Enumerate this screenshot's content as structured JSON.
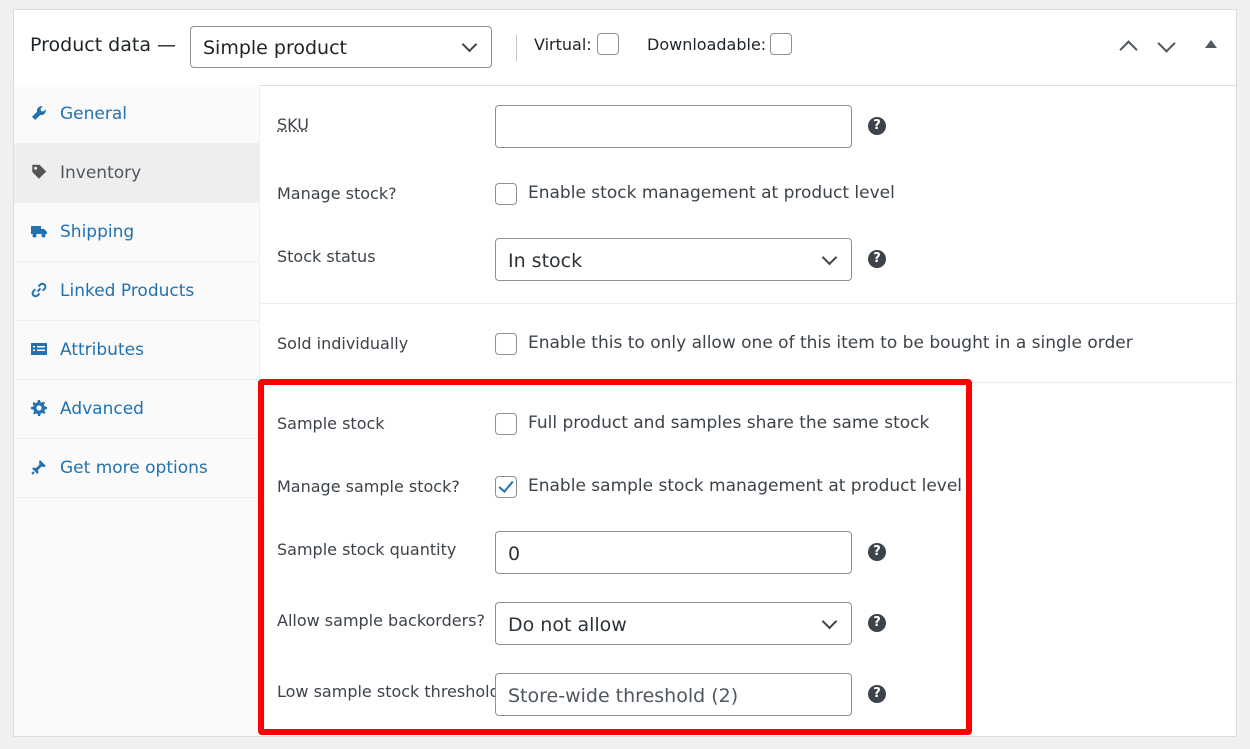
{
  "header": {
    "title": "Product data —",
    "product_type": "Simple product",
    "virtual_label": "Virtual:",
    "downloadable_label": "Downloadable:",
    "controls": [
      "chevron-up-icon",
      "chevron-down-icon",
      "toggle-triangle-icon"
    ]
  },
  "sidebar": {
    "items": [
      {
        "label": "General",
        "icon": "wrench-icon",
        "active": false
      },
      {
        "label": "Inventory",
        "icon": "tag-icon",
        "active": true
      },
      {
        "label": "Shipping",
        "icon": "truck-icon",
        "active": false
      },
      {
        "label": "Linked Products",
        "icon": "link-icon",
        "active": false
      },
      {
        "label": "Attributes",
        "icon": "list-icon",
        "active": false
      },
      {
        "label": "Advanced",
        "icon": "gear-icon",
        "active": false
      },
      {
        "label": "Get more options",
        "icon": "plugin-icon",
        "active": false
      }
    ]
  },
  "inventory": {
    "sku": {
      "label": "SKU",
      "value": ""
    },
    "manage_stock": {
      "label": "Manage stock?",
      "text": "Enable stock management at product level",
      "checked": false
    },
    "stock_status": {
      "label": "Stock status",
      "value": "In stock"
    },
    "sold_individually": {
      "label": "Sold individually",
      "text": "Enable this to only allow one of this item to be bought in a single order",
      "checked": false
    },
    "sample_stock": {
      "label": "Sample stock",
      "text": "Full product and samples share the same stock",
      "checked": false
    },
    "manage_sample_stock": {
      "label": "Manage sample stock?",
      "text": "Enable sample stock management at product level",
      "checked": true
    },
    "sample_stock_quantity": {
      "label": "Sample stock quantity",
      "value": "0"
    },
    "allow_sample_backorders": {
      "label": "Allow sample backorders?",
      "value": "Do not allow"
    },
    "low_sample_stock_threshold": {
      "label": "Low sample stock threshold",
      "placeholder": "Store-wide threshold (2)"
    },
    "help_glyph": "?"
  },
  "colors": {
    "accent": "#2271b1",
    "highlight": "#ff0000"
  }
}
